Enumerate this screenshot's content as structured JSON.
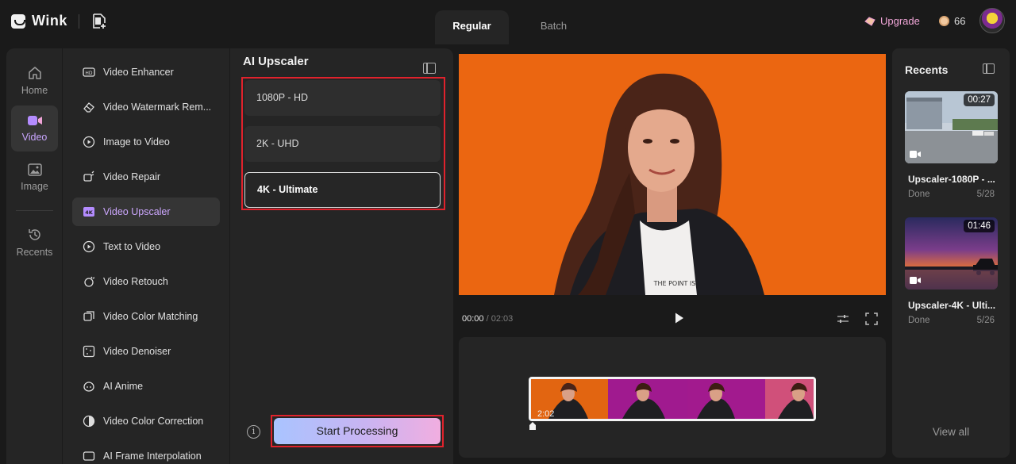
{
  "app": {
    "name": "Wink"
  },
  "mode_tabs": [
    {
      "label": "Regular",
      "active": true
    },
    {
      "label": "Batch",
      "active": false
    }
  ],
  "account": {
    "upgrade_label": "Upgrade",
    "credits": "66"
  },
  "rail": [
    {
      "label": "Home",
      "icon": "home-icon",
      "active": false
    },
    {
      "label": "Video",
      "icon": "video-camera-icon",
      "active": true
    },
    {
      "label": "Image",
      "icon": "image-icon",
      "active": false
    },
    {
      "label": "Recents",
      "icon": "history-icon",
      "active": false
    }
  ],
  "tools": [
    {
      "label": "Video Enhancer",
      "icon": "hd-icon",
      "active": false
    },
    {
      "label": "Video Watermark Rem...",
      "icon": "eraser-icon",
      "active": false
    },
    {
      "label": "Image to Video",
      "icon": "image-to-video-icon",
      "active": false
    },
    {
      "label": "Video Repair",
      "icon": "repair-icon",
      "active": false
    },
    {
      "label": "Video Upscaler",
      "icon": "4k-icon",
      "active": true
    },
    {
      "label": "Text to Video",
      "icon": "text-to-video-icon",
      "active": false
    },
    {
      "label": "Video Retouch",
      "icon": "retouch-icon",
      "active": false
    },
    {
      "label": "Video Color Matching",
      "icon": "color-matching-icon",
      "active": false
    },
    {
      "label": "Video Denoiser",
      "icon": "denoiser-icon",
      "active": false
    },
    {
      "label": "AI Anime",
      "icon": "anime-icon",
      "active": false
    },
    {
      "label": "Video Color Correction",
      "icon": "color-correction-icon",
      "active": false
    },
    {
      "label": "AI Frame Interpolation",
      "icon": "frame-interpolation-icon",
      "active": false
    }
  ],
  "upscaler": {
    "title": "AI Upscaler",
    "options": [
      {
        "label": "1080P - HD",
        "selected": false
      },
      {
        "label": "2K - UHD",
        "selected": false
      },
      {
        "label": "4K - Ultimate",
        "selected": true
      }
    ],
    "start_label": "Start Processing"
  },
  "player": {
    "current_time": "00:00",
    "duration": "02:03"
  },
  "timeline": {
    "clip_duration": "2:02"
  },
  "recents": {
    "title": "Recents",
    "items": [
      {
        "name": "Upscaler-1080P - ...",
        "status": "Done",
        "date": "5/28",
        "duration": "00:27"
      },
      {
        "name": "Upscaler-4K - Ulti...",
        "status": "Done",
        "date": "5/26",
        "duration": "01:46"
      }
    ],
    "view_all_label": "View all"
  },
  "colors": {
    "accent": "#c9a6ff",
    "highlight_box": "#e0222c",
    "background": "#1a1a1a",
    "panel": "#252525"
  }
}
